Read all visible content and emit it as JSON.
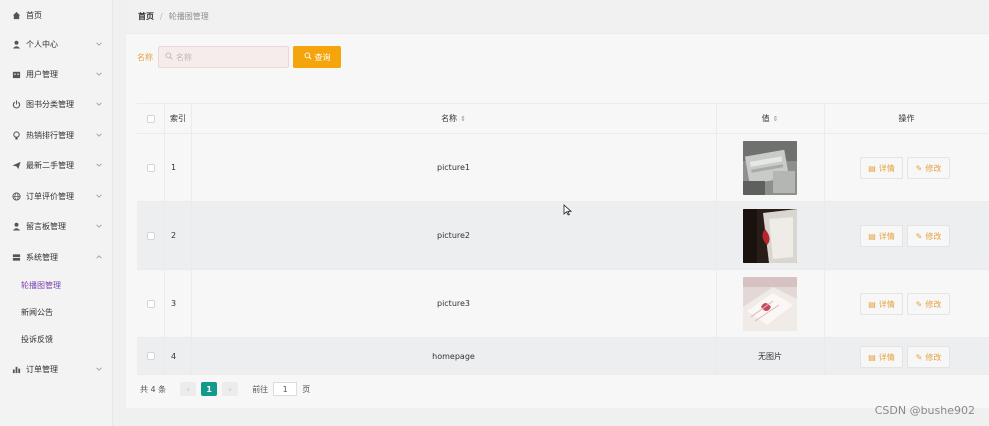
{
  "sidebar": {
    "items": [
      {
        "label": "首页",
        "icon": "home-icon"
      },
      {
        "label": "个人中心",
        "icon": "user-icon"
      },
      {
        "label": "用户管理",
        "icon": "building-icon"
      },
      {
        "label": "图书分类管理",
        "icon": "power-icon"
      },
      {
        "label": "热销排行管理",
        "icon": "bulb-icon"
      },
      {
        "label": "最新二手管理",
        "icon": "send-icon"
      },
      {
        "label": "订单评价管理",
        "icon": "globe-icon"
      },
      {
        "label": "留言板管理",
        "icon": "user-icon"
      },
      {
        "label": "系统管理",
        "icon": "server-icon"
      },
      {
        "label": "订单管理",
        "icon": "chart-icon"
      }
    ],
    "sub_items": [
      {
        "label": "轮播图管理"
      },
      {
        "label": "新闻公告"
      },
      {
        "label": "投诉反馈"
      }
    ]
  },
  "breadcrumb": {
    "home": "首页",
    "separator": "/",
    "current": "轮播图管理"
  },
  "search": {
    "label": "名称",
    "placeholder": "名称",
    "button": "查询"
  },
  "table": {
    "headers": {
      "index": "索引",
      "name": "名称",
      "value": "值",
      "actions": "操作"
    },
    "rows": [
      {
        "index": "1",
        "name": "picture1",
        "value_text": "",
        "image": "printer-photo"
      },
      {
        "index": "2",
        "name": "picture2",
        "value_text": "",
        "image": "book-red-photo"
      },
      {
        "index": "3",
        "name": "picture3",
        "value_text": "",
        "image": "book-pink-photo"
      },
      {
        "index": "4",
        "name": "homepage",
        "value_text": "无图片",
        "image": ""
      }
    ],
    "detail_label": "详情",
    "edit_label": "修改"
  },
  "pager": {
    "total": "共 4 条",
    "current": "1",
    "goto_label": "前往",
    "goto_value": "1",
    "page_suffix": "页"
  },
  "watermark": "CSDN @bushe902",
  "colors": {
    "accent": "#f5a50c",
    "active_menu": "#7b3fb3",
    "pager_active": "#139a8a",
    "label_orange": "#e6a23c"
  }
}
